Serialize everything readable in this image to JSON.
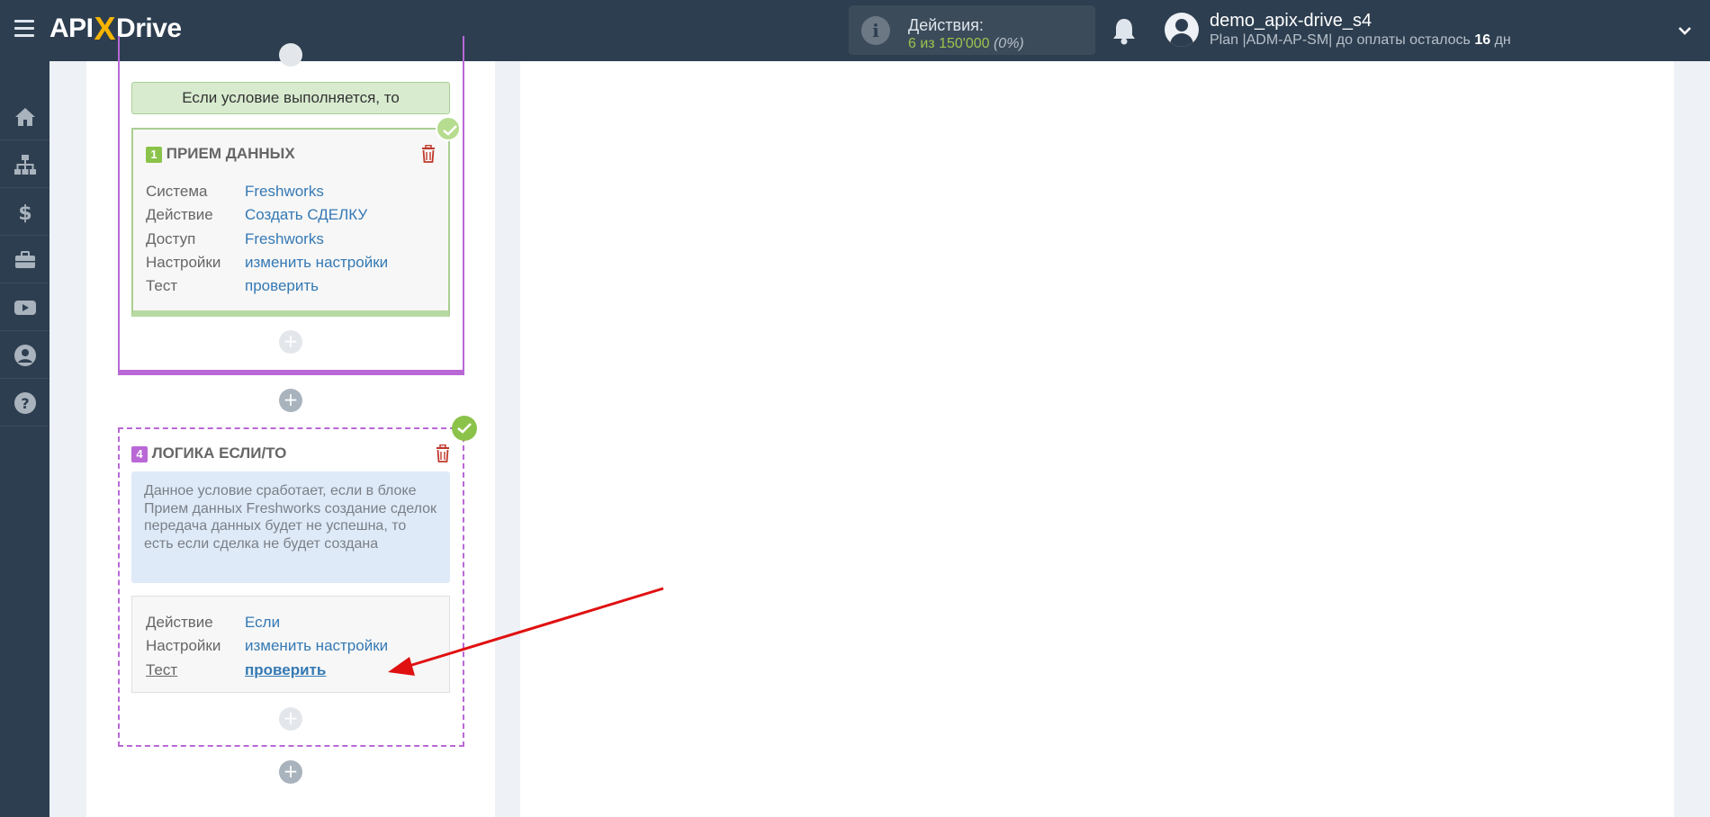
{
  "header": {
    "logo_left": "API",
    "logo_x": "X",
    "logo_right": "Drive",
    "actions_title": "Действия:",
    "actions_count": "6 из 150'000",
    "actions_percent": "(0%)",
    "user_name": "demo_apix-drive_s4",
    "plan_text": "Plan |ADM-AP-SM| до оплаты осталось",
    "plan_days": "16",
    "plan_days_unit": "дн"
  },
  "sidebar": {
    "items": [
      "home-icon",
      "sitemap-icon",
      "dollar-icon",
      "briefcase-icon",
      "youtube-icon",
      "user-icon",
      "help-icon"
    ]
  },
  "flow": {
    "condition_label": "Если условие выполняется, то",
    "block1": {
      "number": "1",
      "title": "ПРИЕМ ДАННЫХ",
      "rows": [
        {
          "key": "Система",
          "value": "Freshworks"
        },
        {
          "key": "Действие",
          "value": "Создать СДЕЛКУ"
        },
        {
          "key": "Доступ",
          "value": "Freshworks"
        },
        {
          "key": "Настройки",
          "value": "изменить настройки"
        },
        {
          "key": "Тест",
          "value": "проверить"
        }
      ]
    },
    "block4": {
      "number": "4",
      "title": "ЛОГИКА ЕСЛИ/ТО",
      "description": "Данное условие сработает, если в блоке Прием данных Freshworks создание сделок передача данных будет не успешна, то есть если сделка не будет создана",
      "rows": [
        {
          "key": "Действие",
          "value": "Если"
        },
        {
          "key": "Настройки",
          "value": "изменить настройки"
        },
        {
          "key": "Тест",
          "value": "проверить"
        }
      ]
    },
    "plus_symbol": "+"
  },
  "colors": {
    "topbar": "#2d3e50",
    "accent_purple": "#b968d6",
    "accent_green": "#8bc34a",
    "link_blue": "#3479b4",
    "arrow_red": "#e01010"
  }
}
